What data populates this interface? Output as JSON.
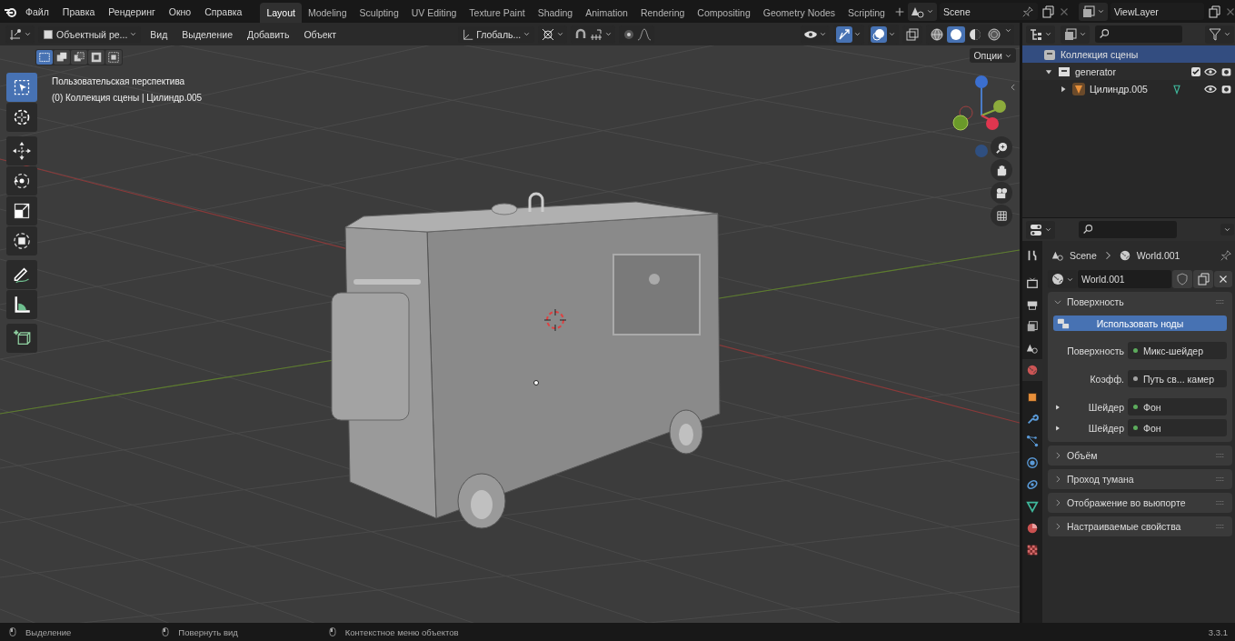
{
  "top_menu": [
    "Файл",
    "Правка",
    "Рендеринг",
    "Окно",
    "Справка"
  ],
  "workspaces": [
    {
      "label": "Layout",
      "selected": true
    },
    {
      "label": "Modeling",
      "selected": false
    },
    {
      "label": "Sculpting",
      "selected": false
    },
    {
      "label": "UV Editing",
      "selected": false
    },
    {
      "label": "Texture Paint",
      "selected": false
    },
    {
      "label": "Shading",
      "selected": false
    },
    {
      "label": "Animation",
      "selected": false
    },
    {
      "label": "Rendering",
      "selected": false
    },
    {
      "label": "Compositing",
      "selected": false
    },
    {
      "label": "Geometry Nodes",
      "selected": false
    },
    {
      "label": "Scripting",
      "selected": false
    }
  ],
  "scene_field": "Scene",
  "view_layer_field": "ViewLayer",
  "viewport_header": {
    "mode_menu": "Объектный ре...",
    "menus": [
      "Вид",
      "Выделение",
      "Добавить",
      "Объект"
    ],
    "orientation_menu": "Глобаль...",
    "gizmos_on": true,
    "overlays_on": true,
    "shading_modes": [
      {
        "kind": "wireframe",
        "selected": false
      },
      {
        "kind": "solid",
        "selected": true
      },
      {
        "kind": "material",
        "selected": false
      },
      {
        "kind": "rendered",
        "selected": false
      }
    ]
  },
  "select_modes": [
    {
      "kind": "new",
      "selected": true
    },
    {
      "kind": "extend",
      "selected": false
    },
    {
      "kind": "subtract",
      "selected": false
    },
    {
      "kind": "invert",
      "selected": false
    },
    {
      "kind": "intersect",
      "selected": false
    }
  ],
  "tools": [
    {
      "kind": "select",
      "selected": true
    },
    {
      "kind": "cursor",
      "selected": false
    },
    {
      "kind": "move",
      "selected": false
    },
    {
      "kind": "rotate",
      "selected": false
    },
    {
      "kind": "scale",
      "selected": false
    },
    {
      "kind": "transform",
      "selected": false
    },
    {
      "kind": "annotate",
      "selected": false
    },
    {
      "kind": "measure",
      "selected": false
    },
    {
      "kind": "add_cube",
      "selected": false
    }
  ],
  "viewport": {
    "options_menu": "Опции",
    "view_name": "Пользовательская перспектива",
    "object_info": "(0) Коллекция сцены | Цилиндр.005"
  },
  "outliner": {
    "items": [
      {
        "label": "Коллекция сцены",
        "kind": "scene_collection",
        "selected": true,
        "children": [
          {
            "label": "generator",
            "kind": "collection",
            "selected": false,
            "expanded": true,
            "checked": true,
            "children": [
              {
                "label": "Цилиндр.005",
                "kind": "mesh",
                "selected": false,
                "expanded": false
              }
            ]
          }
        ]
      }
    ]
  },
  "properties": {
    "tabs": [
      {
        "kind": "tool",
        "selected": false
      },
      {
        "kind": "render",
        "selected": false
      },
      {
        "kind": "output",
        "selected": false
      },
      {
        "kind": "view_layer",
        "selected": false
      },
      {
        "kind": "scene",
        "selected": false
      },
      {
        "kind": "world",
        "selected": true
      },
      {
        "kind": "object",
        "selected": false
      },
      {
        "kind": "modifiers",
        "selected": false
      },
      {
        "kind": "particles",
        "selected": false
      },
      {
        "kind": "physics",
        "selected": false
      },
      {
        "kind": "constraints",
        "selected": false
      },
      {
        "kind": "data",
        "selected": false
      },
      {
        "kind": "material",
        "selected": false
      },
      {
        "kind": "texture",
        "selected": false
      }
    ],
    "breadcrumb": [
      "Scene",
      "World.001"
    ],
    "world_field": "World.001",
    "panels": [
      {
        "title": "Поверхность",
        "expanded": true,
        "use_nodes_button": "Использовать ноды",
        "rows": [
          {
            "label": "Поверхность",
            "value": "Микс-шейдер",
            "color": "#5cab5c",
            "kind": "plain"
          },
          {
            "label": "Коэфф.",
            "value": "Путь св... камер",
            "color": "#a3a3a3",
            "kind": "plain"
          },
          {
            "label": "Шейдер",
            "value": "Фон",
            "color": "#5cab5c",
            "kind": "sub"
          },
          {
            "label": "Шейдер",
            "value": "Фон",
            "color": "#5cab5c",
            "kind": "sub"
          }
        ]
      },
      {
        "title": "Объём",
        "expanded": false
      },
      {
        "title": "Проход тумана",
        "expanded": false
      },
      {
        "title": "Отображение во вьюпорте",
        "expanded": false
      },
      {
        "title": "Настраиваемые свойства",
        "expanded": false
      }
    ]
  },
  "status_bar": {
    "hints": [
      "Выделение",
      "Повернуть вид",
      "Контекстное меню объектов"
    ],
    "version": "3.3.1"
  }
}
